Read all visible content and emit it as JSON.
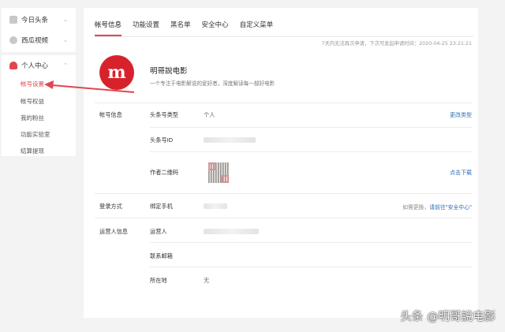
{
  "sidebar": {
    "top": [
      {
        "label": "今日头条"
      },
      {
        "label": "西瓜视频"
      }
    ],
    "personal": {
      "label": "个人中心",
      "items": [
        {
          "label": "帐号设置"
        },
        {
          "label": "帐号权益"
        },
        {
          "label": "我的粉丝"
        },
        {
          "label": "功能实验室"
        },
        {
          "label": "结算提现"
        }
      ]
    }
  },
  "tabs": [
    {
      "label": "帐号信息"
    },
    {
      "label": "功能设置"
    },
    {
      "label": "黑名单"
    },
    {
      "label": "安全中心"
    },
    {
      "label": "自定义菜单"
    }
  ],
  "notice": "7天内无法再次申请，下次可发起申请时间：2020-04-25 23:21:21",
  "profile": {
    "name": "明哥說电影",
    "description": "一个专注于电影解说的爱好者，深度解读每一部好电影"
  },
  "account_info": {
    "section_label": "帐号信息",
    "type_label": "头条号类型",
    "type_value": "个人",
    "type_action": "更改类型",
    "id_label": "头条号ID",
    "qr_label": "作者二维码",
    "qr_action": "点击下载"
  },
  "login": {
    "section_label": "登录方式",
    "phone_label": "绑定手机",
    "hint": "如需更换，",
    "hint_link": "请前往\"安全中心\""
  },
  "operator": {
    "section_label": "运营人信息",
    "operator_label": "运营人",
    "email_label": "联系邮箱",
    "location_label": "所在地",
    "location_value": "无"
  },
  "watermark": "头条 @明哥說电影",
  "colors": {
    "accent": "#e0474f",
    "link": "#2d6db5",
    "logo": "#d8222b"
  }
}
